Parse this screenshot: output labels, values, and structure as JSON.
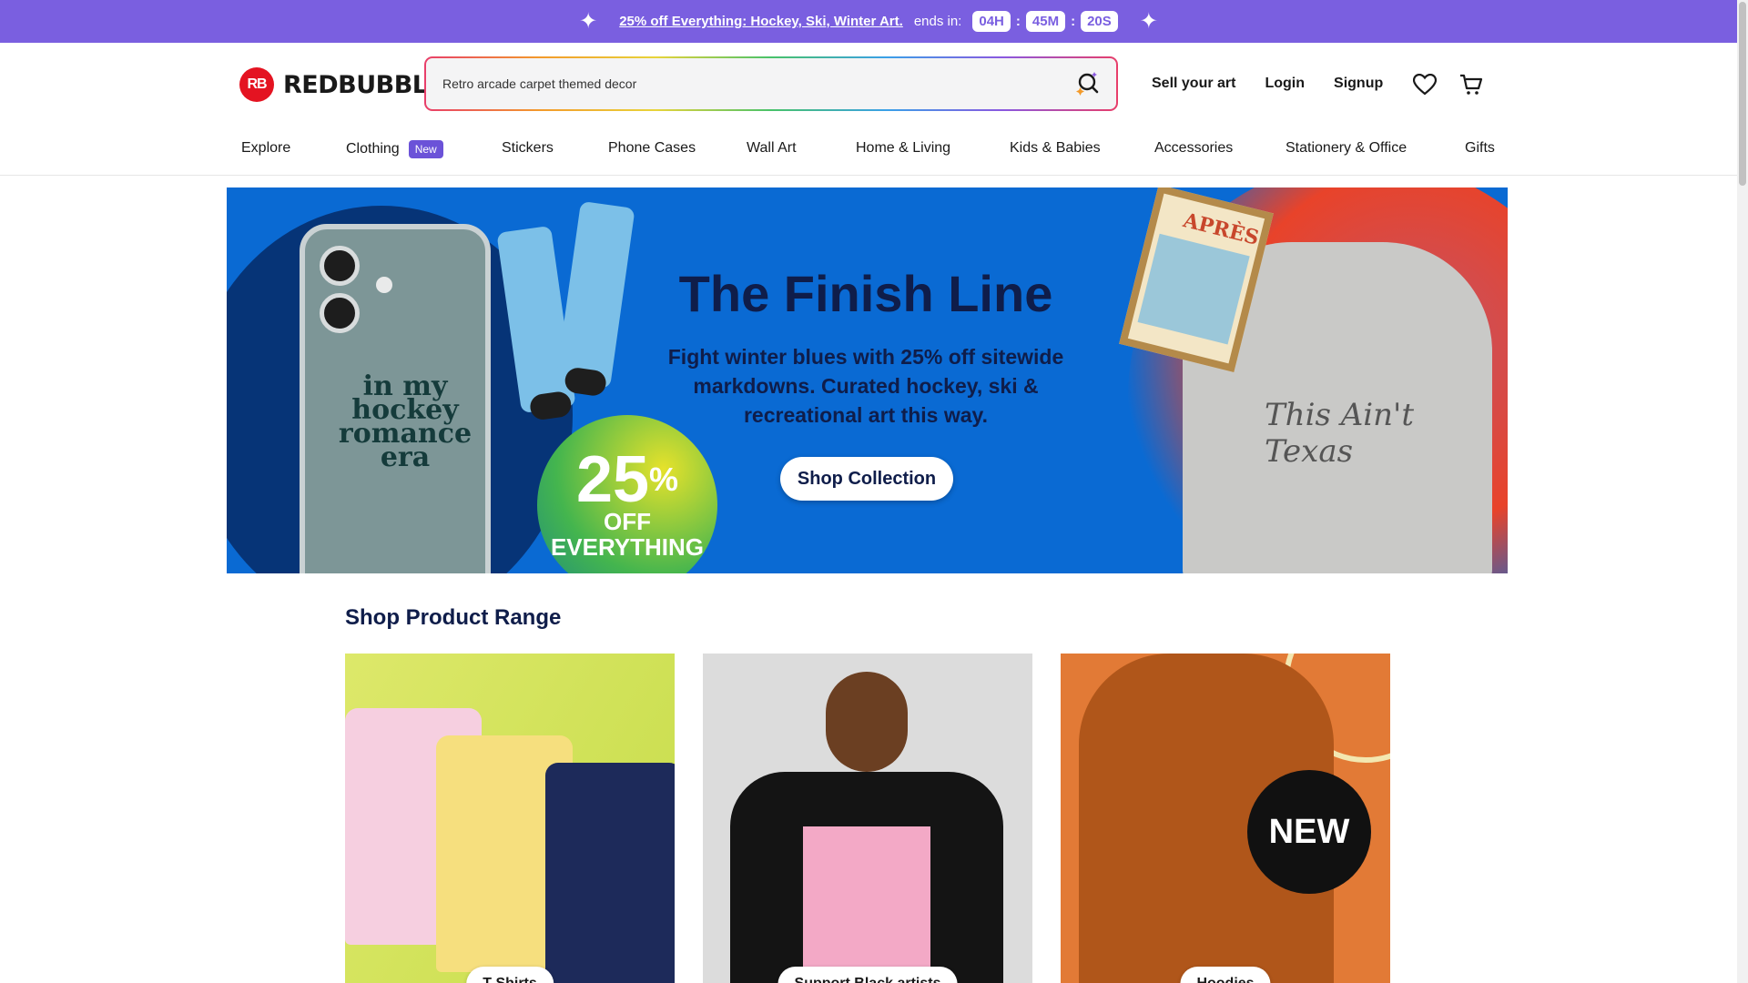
{
  "promo": {
    "link_text": "25% off Everything: Hockey, Ski, Winter Art.",
    "ends_text": "ends in:",
    "hours": "04H",
    "minutes": "45M",
    "seconds": "20S"
  },
  "header": {
    "logo_mark": "RB",
    "logo_text": "REDBUBBLE",
    "search_value": "Retro arcade carpet themed decor",
    "sell_label": "Sell your art",
    "login_label": "Login",
    "signup_label": "Signup"
  },
  "catnav": {
    "items": [
      "Explore",
      "Clothing",
      "Stickers",
      "Phone Cases",
      "Wall Art",
      "Home & Living",
      "Kids & Babies",
      "Accessories",
      "Stationery & Office",
      "Gifts"
    ],
    "new_badge": "New"
  },
  "hero": {
    "title": "The Finish Line",
    "subtitle": "Fight winter blues with 25% off sitewide markdowns. Curated hockey, ski & recreational art this way.",
    "cta": "Shop Collection",
    "badge_big": "25",
    "badge_pct": "%",
    "badge_off": "OFF",
    "badge_everything": "EVERYTHING",
    "phone_text": "in my hockey romance era",
    "poster_text": "APRÈS",
    "hoodie_text": "This Ain't Texas"
  },
  "section": {
    "title": "Shop Product Range",
    "cards": [
      "T-Shirts",
      "Support Black artists",
      "Hoodies"
    ],
    "new_tag": "NEW"
  },
  "colors": {
    "promo_bg": "#7a5fe0",
    "brand_red": "#e41321",
    "hero_bg": "#0a6ad3",
    "heading": "#0f1d4a"
  }
}
